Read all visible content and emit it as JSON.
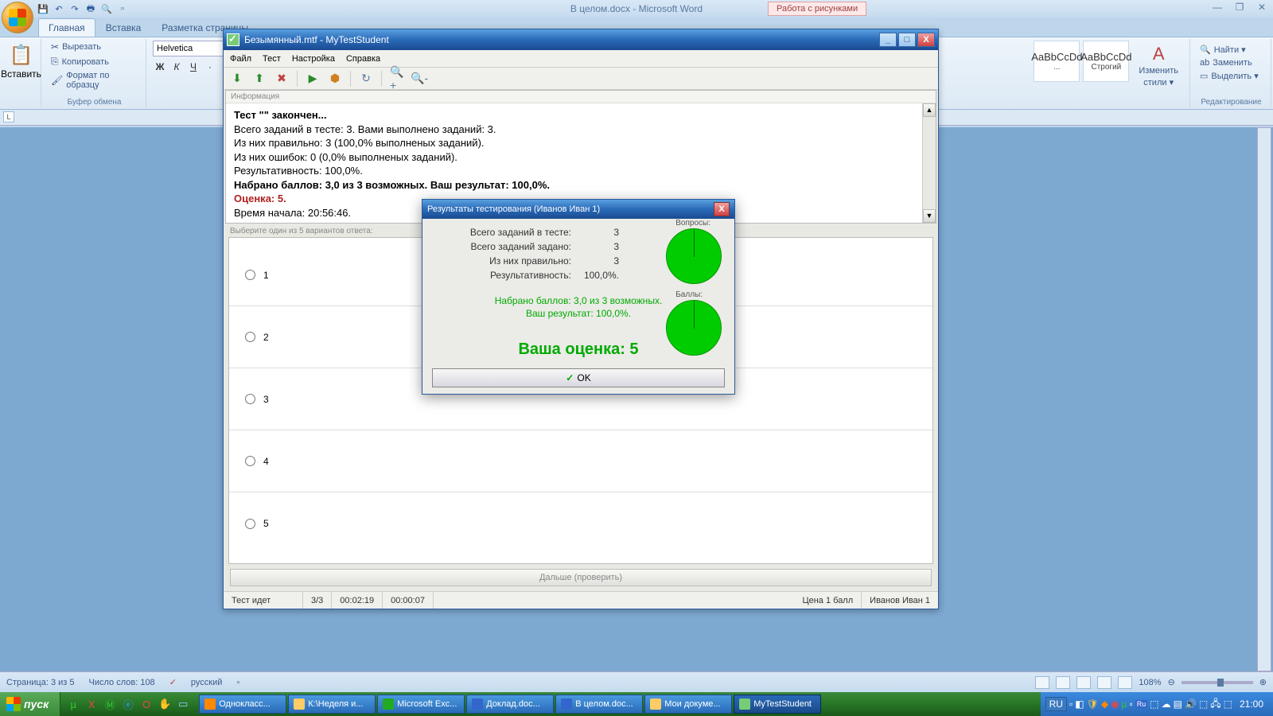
{
  "word": {
    "title": "В целом.docx - Microsoft Word",
    "context_tab": "Работа с рисунками",
    "tabs": [
      "Главная",
      "Вставка",
      "Разметка страницы"
    ],
    "clipboard": {
      "paste": "Вставить",
      "cut": "Вырезать",
      "copy": "Копировать",
      "format": "Формат по образцу",
      "group": "Буфер обмена"
    },
    "font": {
      "name": "Helvetica",
      "bold": "Ж",
      "italic": "К",
      "under": "Ч"
    },
    "styles": {
      "preview": "AaBbCcDd",
      "strict": "Строгий",
      "change": "Изменить",
      "styles": "стили ▾"
    },
    "editing": {
      "find": "Найти ▾",
      "replace": "Заменить",
      "select": "Выделить ▾",
      "group": "Редактирование"
    },
    "ruler_btn": "L",
    "status": {
      "page": "Страница: 3 из 5",
      "words": "Число слов: 108",
      "lang": "русский",
      "zoom": "108%"
    }
  },
  "mts": {
    "title": "Безымянный.mtf - MyTestStudent",
    "menu": [
      "Файл",
      "Тест",
      "Настройка",
      "Справка"
    ],
    "info_header": "Информация",
    "info_lines": {
      "done": "Тест \"\" закончен...",
      "l1": "Всего заданий в тесте: 3. Вами выполнено заданий: 3.",
      "l2": "Из них правильно: 3 (100,0% выполненых заданий).",
      "l3": "Из них ошибок: 0 (0,0% выполненых заданий).",
      "l4": "Результативность: 100,0%.",
      "l5": "Набрано баллов: 3,0 из 3 возможных. Ваш результат: 100,0%.",
      "l6": "Оценка: 5.",
      "l7": "Время начала: 20:56:46."
    },
    "q_header": "Выберите один из 5 вариантов ответа:",
    "options": [
      "1",
      "2",
      "3",
      "4",
      "5"
    ],
    "next": "Дальше (проверить)",
    "status": {
      "state": "Тест идет",
      "progress": "3/3",
      "t1": "00:02:19",
      "t2": "00:00:07",
      "price": "Цена 1 балл",
      "user": "Иванов Иван 1"
    }
  },
  "dialog": {
    "title": "Результаты тестирования (Иванов Иван 1)",
    "rows": [
      {
        "label": "Всего заданий в тесте:",
        "value": "3"
      },
      {
        "label": "Всего заданий задано:",
        "value": "3"
      },
      {
        "label": "Из них правильно:",
        "value": "3"
      },
      {
        "label": "Результативность:",
        "value": "100,0%."
      }
    ],
    "pie1_label": "Вопросы:",
    "pie2_label": "Баллы:",
    "score1": "Набрано баллов: 3,0 из 3 возможных.",
    "score2": "Ваш результат: 100,0%.",
    "grade": "Ваша оценка: 5",
    "ok": "OK"
  },
  "taskbar": {
    "start": "пуск",
    "items": [
      "Однокласс...",
      "К:\\Неделя и...",
      "Microsoft Exc...",
      "Доклад.doc...",
      "В целом.doc...",
      "Мои докуме...",
      "MyTestStudent"
    ],
    "lang": "RU",
    "clock": "21:00"
  },
  "chart_data": [
    {
      "type": "pie",
      "title": "Вопросы",
      "series": [
        {
          "name": "Правильно",
          "value": 3
        }
      ],
      "total": 3
    },
    {
      "type": "pie",
      "title": "Баллы",
      "series": [
        {
          "name": "Набрано",
          "value": 3.0
        }
      ],
      "total": 3
    }
  ]
}
